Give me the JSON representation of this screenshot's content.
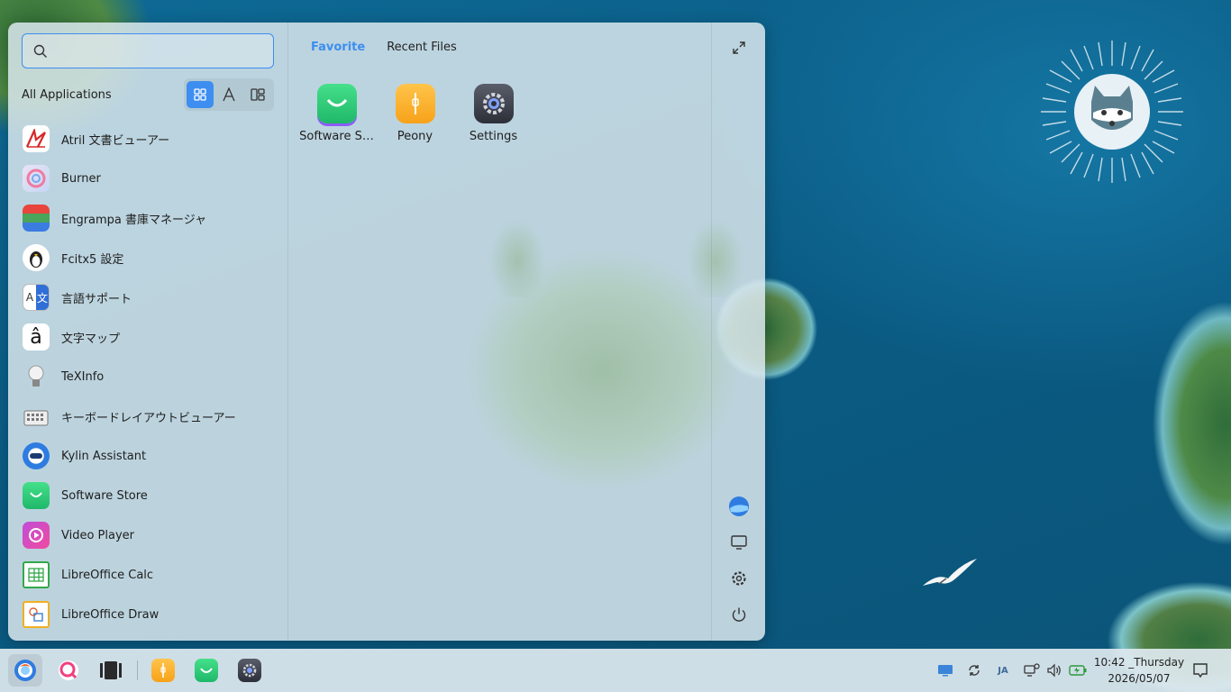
{
  "search": {
    "placeholder": ""
  },
  "left_panel": {
    "title": "All Applications",
    "view_modes": [
      "grid-view",
      "alphabetical-view",
      "category-view"
    ],
    "apps": [
      {
        "label": "Atril 文書ビューアー",
        "icon": "atril-document-viewer-icon"
      },
      {
        "label": "Burner",
        "icon": "burner-icon"
      },
      {
        "label": "Engrampa 書庫マネージャ",
        "icon": "engrampa-archive-icon"
      },
      {
        "label": "Fcitx5 設定",
        "icon": "fcitx-penguin-icon"
      },
      {
        "label": "言語サポート",
        "icon": "language-support-icon"
      },
      {
        "label": "文字マップ",
        "icon": "character-map-icon"
      },
      {
        "label": "TeXInfo",
        "icon": "texinfo-bulb-icon"
      },
      {
        "label": "キーボードレイアウトビューアー",
        "icon": "keyboard-layout-icon"
      },
      {
        "label": "Kylin Assistant",
        "icon": "kylin-assistant-icon"
      },
      {
        "label": "Software Store",
        "icon": "software-store-icon"
      },
      {
        "label": "Video Player",
        "icon": "video-player-icon"
      },
      {
        "label": "LibreOffice Calc",
        "icon": "libreoffice-calc-icon"
      },
      {
        "label": "LibreOffice Draw",
        "icon": "libreoffice-draw-icon"
      }
    ]
  },
  "middle_panel": {
    "tabs": [
      {
        "label": "Favorite",
        "active": true
      },
      {
        "label": "Recent Files",
        "active": false
      }
    ],
    "favorites": [
      {
        "label": "Software S…",
        "icon": "software-store-icon"
      },
      {
        "label": "Peony",
        "icon": "peony-file-manager-icon"
      },
      {
        "label": "Settings",
        "icon": "settings-gear-icon"
      }
    ]
  },
  "right_rail": {
    "top": "expand-icon",
    "bottom": [
      "user-avatar-icon",
      "monitor-icon",
      "gear-icon",
      "power-icon"
    ]
  },
  "taskbar": {
    "apps": [
      "start-menu-icon",
      "search-icon",
      "multitask-view-icon",
      "peony-file-manager-icon",
      "software-store-icon",
      "settings-gear-icon"
    ],
    "tray": [
      "display-icon",
      "sync-icon",
      "input-method-icon",
      "network-icon",
      "volume-icon",
      "battery-icon"
    ],
    "input_method": "JA",
    "clock_time": "10:42 _Thursday",
    "clock_date": "2026/05/07"
  },
  "colors": {
    "accent": "#3d8ef0",
    "menu_bg": "#dae6ec",
    "taskbar_bg": "#dee8ee",
    "ocean": "#0f5f86"
  }
}
